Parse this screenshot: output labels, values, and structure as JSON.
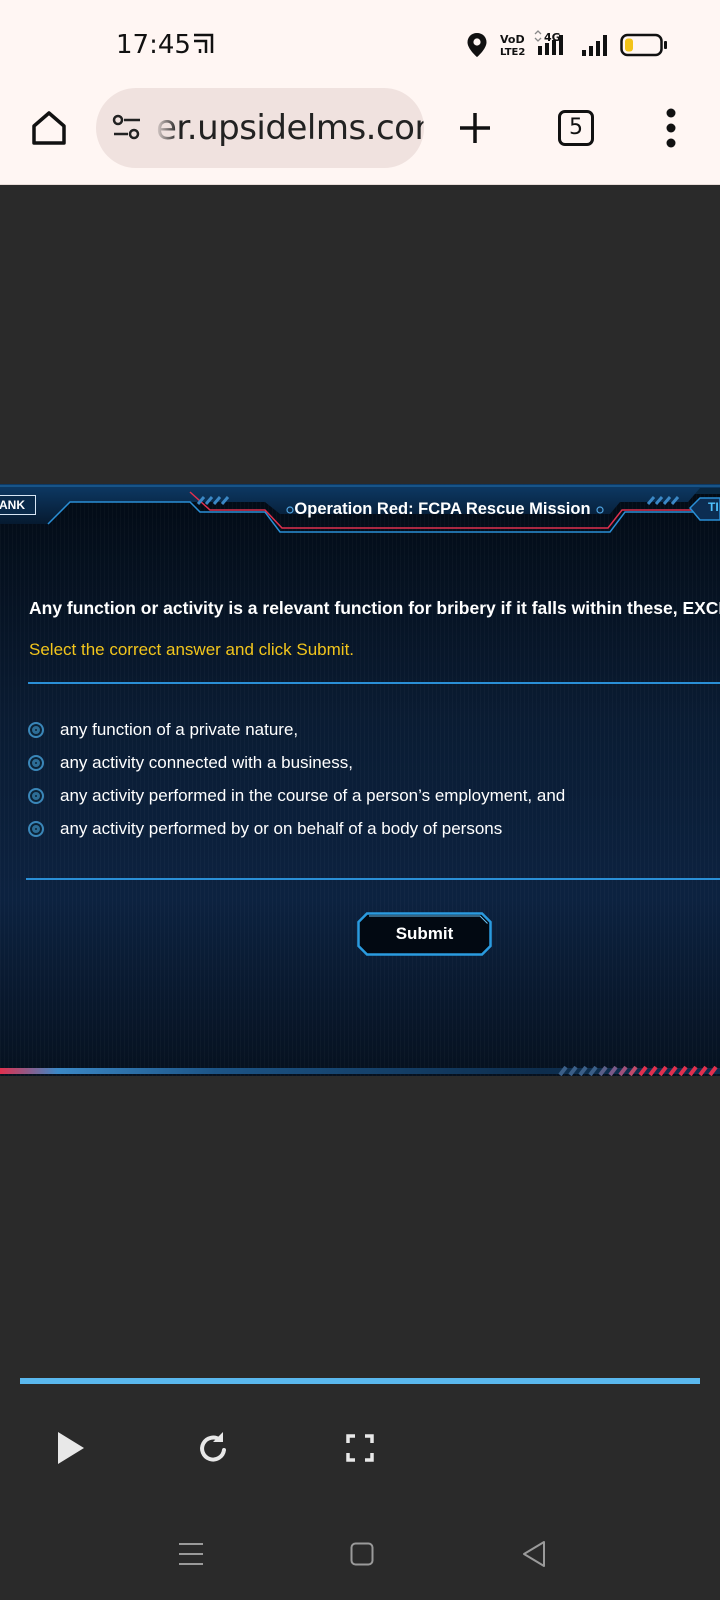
{
  "status_bar": {
    "time": "17:45",
    "network": "4G",
    "volte": "VoLTE2",
    "battery_color": "#f2c318"
  },
  "browser": {
    "url": "er.upsidelms.com",
    "tab_count": "5",
    "icons": [
      "home-icon",
      "site-settings-icon",
      "new-tab-icon",
      "tab-switcher-icon",
      "more-options-icon"
    ]
  },
  "player": {
    "header_title": "Operation Red: FCPA Rescue Mission",
    "rank_label": "ANK",
    "time_label": "TI",
    "question": "Any function or activity is a relevant function for bribery  if it falls within these, EXCEPT",
    "instruction": "Select the correct answer and click Submit.",
    "options": [
      "any function of a private nature,",
      "any activity connected with a business,",
      "any activity performed in the course of a person’s employment, and",
      "any activity performed by or on behalf of a body of persons"
    ],
    "submit_label": "Submit",
    "colors": {
      "accent_blue": "#2a8fd6",
      "accent_red": "#e0304e",
      "instruction_yellow": "#f2c51c"
    }
  },
  "media_controls": {
    "progress": 1.0,
    "icons": [
      "play-icon",
      "replay-icon",
      "fullscreen-icon"
    ]
  },
  "nav_bar": {
    "icons": [
      "recent-apps-icon",
      "home-nav-icon",
      "back-icon"
    ]
  }
}
